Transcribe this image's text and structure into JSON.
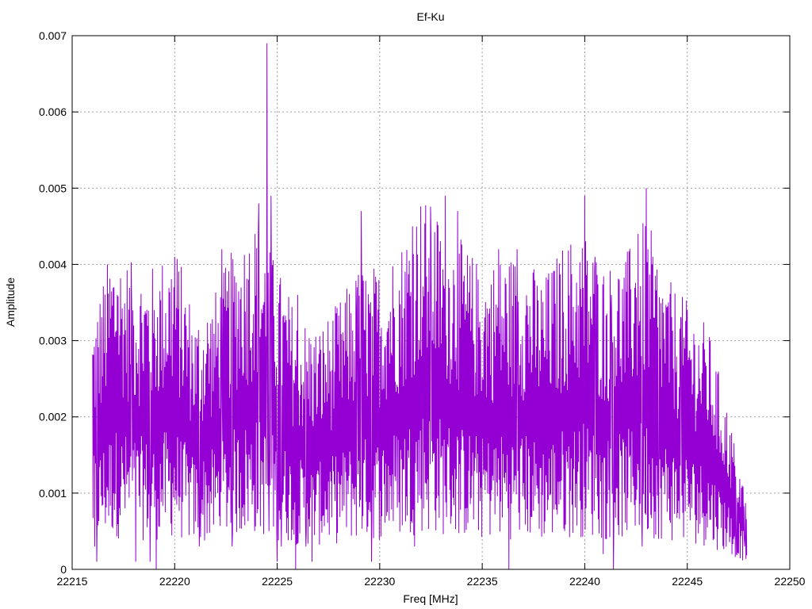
{
  "chart_data": {
    "type": "line",
    "title": "Ef-Ku",
    "xlabel": "Freq [MHz]",
    "ylabel": "Amplitude",
    "xlim": [
      22215,
      22250
    ],
    "ylim": [
      0,
      0.007
    ],
    "grid": true,
    "x_ticks": [
      "22215",
      "22220",
      "22225",
      "22230",
      "22235",
      "22240",
      "22245",
      "22250"
    ],
    "y_ticks": [
      "0",
      "0.001",
      "0.002",
      "0.003",
      "0.004",
      "0.005",
      "0.006",
      "0.007"
    ],
    "series": [
      {
        "color": "#9400d3",
        "x_start": 22216.0,
        "x_end": 22247.9,
        "envelope": [
          [
            22216.0,
            0.0021
          ],
          [
            22217.0,
            0.0027
          ],
          [
            22218.0,
            0.0025
          ],
          [
            22219.0,
            0.0025
          ],
          [
            22220.0,
            0.0027
          ],
          [
            22221.0,
            0.0021
          ],
          [
            22222.0,
            0.0023
          ],
          [
            22223.0,
            0.0027
          ],
          [
            22224.0,
            0.0029
          ],
          [
            22225.0,
            0.0025
          ],
          [
            22226.0,
            0.0021
          ],
          [
            22227.0,
            0.002
          ],
          [
            22228.0,
            0.0022
          ],
          [
            22229.0,
            0.0025
          ],
          [
            22230.0,
            0.0025
          ],
          [
            22231.0,
            0.0027
          ],
          [
            22232.0,
            0.0031
          ],
          [
            22233.0,
            0.0029
          ],
          [
            22234.0,
            0.0027
          ],
          [
            22235.0,
            0.0025
          ],
          [
            22236.0,
            0.0026
          ],
          [
            22237.0,
            0.0026
          ],
          [
            22238.0,
            0.0024
          ],
          [
            22239.0,
            0.0027
          ],
          [
            22240.0,
            0.0028
          ],
          [
            22241.0,
            0.0025
          ],
          [
            22242.0,
            0.0026
          ],
          [
            22243.0,
            0.0029
          ],
          [
            22244.0,
            0.0024
          ],
          [
            22245.0,
            0.0022
          ],
          [
            22246.0,
            0.002
          ],
          [
            22247.0,
            0.0013
          ],
          [
            22247.9,
            0.0006
          ]
        ],
        "peaks": [
          [
            22217.2,
            0.0036
          ],
          [
            22217.9,
            0.0035
          ],
          [
            22218.8,
            0.0035
          ],
          [
            22219.0,
            0.0034
          ],
          [
            22220.0,
            0.0041
          ],
          [
            22222.3,
            0.0042
          ],
          [
            22223.6,
            0.0038
          ],
          [
            22224.1,
            0.0048
          ],
          [
            22224.5,
            0.0069
          ],
          [
            22224.7,
            0.0049
          ],
          [
            22226.0,
            0.0036
          ],
          [
            22228.9,
            0.0037
          ],
          [
            22229.1,
            0.0047
          ],
          [
            22231.6,
            0.0045
          ],
          [
            22232.5,
            0.0044
          ],
          [
            22233.2,
            0.0049
          ],
          [
            22233.8,
            0.0047
          ],
          [
            22234.8,
            0.0038
          ],
          [
            22235.8,
            0.0042
          ],
          [
            22236.7,
            0.0042
          ],
          [
            22238.2,
            0.0038
          ],
          [
            22240.0,
            0.0049
          ],
          [
            22240.5,
            0.0041
          ],
          [
            22241.3,
            0.0036
          ],
          [
            22242.6,
            0.0044
          ],
          [
            22243.0,
            0.005
          ],
          [
            22243.4,
            0.0033
          ],
          [
            22244.7,
            0.0033
          ],
          [
            22245.0,
            0.0034
          ]
        ],
        "dips": [
          [
            22216.1,
            0.0003
          ],
          [
            22216.2,
            0.0001
          ],
          [
            22218.1,
            0.0001
          ],
          [
            22218.8,
            0.0001
          ],
          [
            22219.1,
            0.0
          ],
          [
            22221.2,
            0.0003
          ],
          [
            22222.8,
            0.0003
          ],
          [
            22224.6,
            0.0005
          ],
          [
            22225.0,
            0.0001
          ],
          [
            22225.2,
            0.0003
          ],
          [
            22225.9,
            0.0
          ],
          [
            22226.4,
            0.0003
          ],
          [
            22226.7,
            0.0001
          ],
          [
            22229.6,
            0.0001
          ],
          [
            22231.7,
            0.0003
          ],
          [
            22236.3,
            0.0
          ],
          [
            22240.9,
            0.0002
          ],
          [
            22241.4,
            0.0
          ],
          [
            22242.8,
            0.0003
          ],
          [
            22243.6,
            0.0004
          ],
          [
            22247.4,
            0.0002
          ],
          [
            22247.8,
            0.0003
          ]
        ]
      }
    ]
  }
}
